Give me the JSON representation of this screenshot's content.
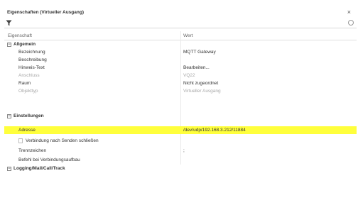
{
  "window": {
    "title": "Eigenschaften (Virtueller Ausgang)",
    "close_symbol": "×"
  },
  "toolbar": {
    "filter_icon": "funnel-icon",
    "clear_icon": "clear-circle-icon"
  },
  "columns": {
    "name": "Eigenschaft",
    "value": "Wert"
  },
  "sections": {
    "allgemein": {
      "label": "Allgemein",
      "rows": [
        {
          "name": "Bezeichnung",
          "value": "MQTT Gateway"
        },
        {
          "name": "Beschreibung",
          "value": ""
        },
        {
          "name": "Hinweis-Text",
          "value": "Bearbeiten..."
        },
        {
          "name": "Anschluss",
          "value": "VQ22"
        },
        {
          "name": "Raum",
          "value": "Nicht zugeordnet"
        },
        {
          "name": "Objekttyp",
          "value": "Virtueller Ausgang"
        }
      ]
    },
    "einstellungen": {
      "label": "Einstellungen",
      "rows": [
        {
          "name": "Adresse",
          "value": "/dev/udp/192.168.3.212/11884"
        },
        {
          "name": "Verbindung nach Senden schließen",
          "value": ""
        },
        {
          "name": "Trennzeichen",
          "value": ";"
        },
        {
          "name": "Befehl bei Verbindungsaufbau",
          "value": ""
        }
      ]
    },
    "logging": {
      "label": "Logging/Mail/Call/Track"
    }
  },
  "colors": {
    "highlight": "#ffff3c",
    "disabled_text": "#a8a8a8"
  }
}
